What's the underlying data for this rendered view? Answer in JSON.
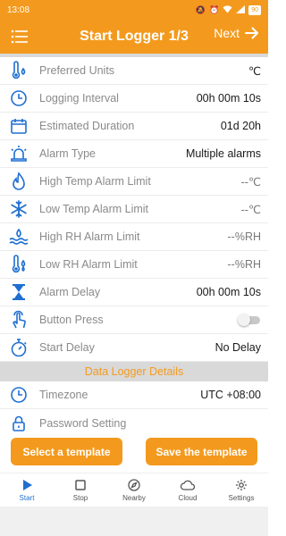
{
  "status_bar": {
    "time": "13:08",
    "battery": "90"
  },
  "header": {
    "title": "Start Logger 1/3",
    "next_label": "Next"
  },
  "rows_top": [
    {
      "icon": "thermometer-drop-icon",
      "label": "Preferred Units",
      "value": "℃",
      "muted": false
    },
    {
      "icon": "clock-icon",
      "label": "Logging Interval",
      "value": "00h 00m 10s",
      "muted": false
    },
    {
      "icon": "calendar-icon",
      "label": "Estimated Duration",
      "value": "01d 20h",
      "muted": false
    },
    {
      "icon": "siren-icon",
      "label": "Alarm Type",
      "value": "Multiple alarms",
      "muted": false
    },
    {
      "icon": "flame-icon",
      "label": "High Temp Alarm Limit",
      "value": "--℃",
      "muted": true
    },
    {
      "icon": "snowflake-icon",
      "label": "Low Temp Alarm Limit",
      "value": "--℃",
      "muted": true
    },
    {
      "icon": "humidity-high-icon",
      "label": "High RH Alarm Limit",
      "value": "--%RH",
      "muted": true
    },
    {
      "icon": "humidity-low-icon",
      "label": "Low RH Alarm Limit",
      "value": "--%RH",
      "muted": true
    },
    {
      "icon": "hourglass-icon",
      "label": "Alarm Delay",
      "value": "00h 00m 10s",
      "muted": false
    },
    {
      "icon": "hand-tap-icon",
      "label": "Button Press",
      "value": "",
      "muted": false
    },
    {
      "icon": "stopwatch-icon",
      "label": "Start Delay",
      "value": "No Delay",
      "muted": false
    }
  ],
  "section_details": {
    "title": "Data Logger Details"
  },
  "rows_details": [
    {
      "icon": "clock-icon",
      "label": "Timezone",
      "value": "UTC +08:00"
    },
    {
      "icon": "lock-icon",
      "label": "Password Setting",
      "value": ""
    }
  ],
  "buttons": {
    "select_template": "Select a template",
    "save_template": "Save the template"
  },
  "nav": [
    {
      "icon": "play-icon",
      "label": "Start",
      "active": true
    },
    {
      "icon": "stop-icon",
      "label": "Stop",
      "active": false
    },
    {
      "icon": "compass-icon",
      "label": "Nearby",
      "active": false
    },
    {
      "icon": "cloud-icon",
      "label": "Cloud",
      "active": false
    },
    {
      "icon": "gear-icon",
      "label": "Settings",
      "active": false
    }
  ],
  "colors": {
    "accent": "#f39a1e",
    "icon_blue": "#1f6fd1",
    "section_bg": "#d9d9d9"
  }
}
